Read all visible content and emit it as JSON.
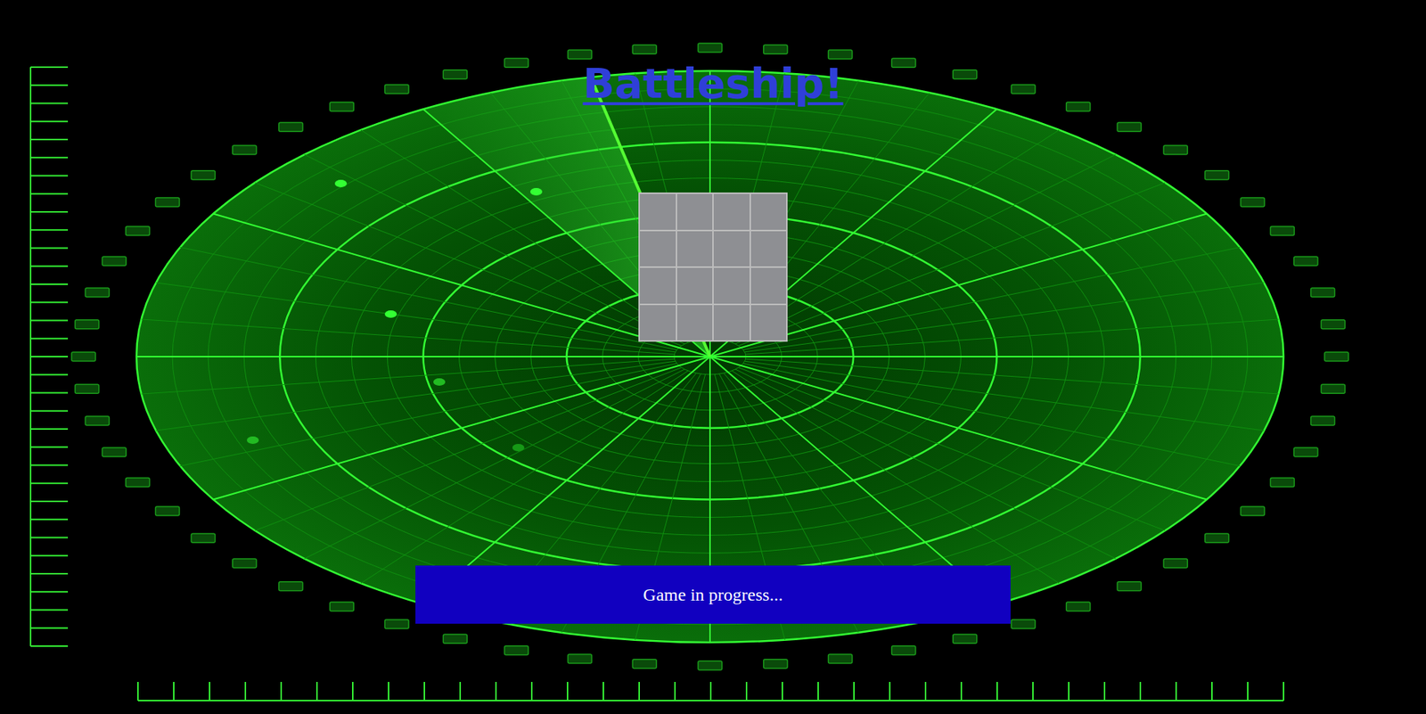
{
  "title": "Battleship!",
  "board": {
    "cells": [
      [
        {
          "revealed": false
        },
        {
          "revealed": false
        },
        {
          "revealed": false
        },
        {
          "revealed": false
        }
      ],
      [
        {
          "revealed": false
        },
        {
          "revealed": false
        },
        {
          "revealed": false
        },
        {
          "revealed": false
        }
      ],
      [
        {
          "revealed": false
        },
        {
          "revealed": false
        },
        {
          "revealed": false
        },
        {
          "revealed": false
        }
      ],
      [
        {
          "revealed": false
        },
        {
          "revealed": false
        },
        {
          "revealed": false
        },
        {
          "revealed": false
        }
      ]
    ]
  },
  "status": "Game in progress..."
}
